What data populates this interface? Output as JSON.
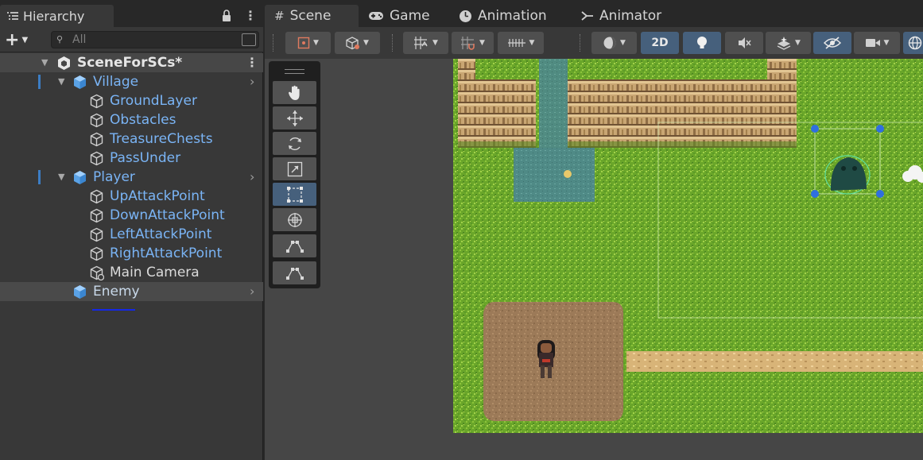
{
  "hierarchy": {
    "title": "Hierarchy",
    "search_placeholder": "All",
    "scene_name": "SceneForSCs*",
    "items": [
      {
        "label": "Village",
        "type": "prefab"
      },
      {
        "label": "GroundLayer",
        "type": "child"
      },
      {
        "label": "Obstacles",
        "type": "child"
      },
      {
        "label": "TreasureChests",
        "type": "child"
      },
      {
        "label": "PassUnder",
        "type": "child"
      },
      {
        "label": "Player",
        "type": "prefab"
      },
      {
        "label": "UpAttackPoint",
        "type": "child"
      },
      {
        "label": "DownAttackPoint",
        "type": "child"
      },
      {
        "label": "LeftAttackPoint",
        "type": "child"
      },
      {
        "label": "RightAttackPoint",
        "type": "child"
      },
      {
        "label": "Main Camera",
        "type": "camera"
      },
      {
        "label": "Enemy",
        "type": "prefab"
      }
    ]
  },
  "tabs": {
    "scene": "Scene",
    "game": "Game",
    "animation": "Animation",
    "animator": "Animator"
  },
  "toolbar": {
    "mode_2d": "2D"
  },
  "colors": {
    "prefab_blue": "#7ab4f5",
    "selection_blue": "#46607c",
    "grass": "#6aa62a",
    "dirt": "#9c7a58",
    "water": "#4f8a86"
  }
}
